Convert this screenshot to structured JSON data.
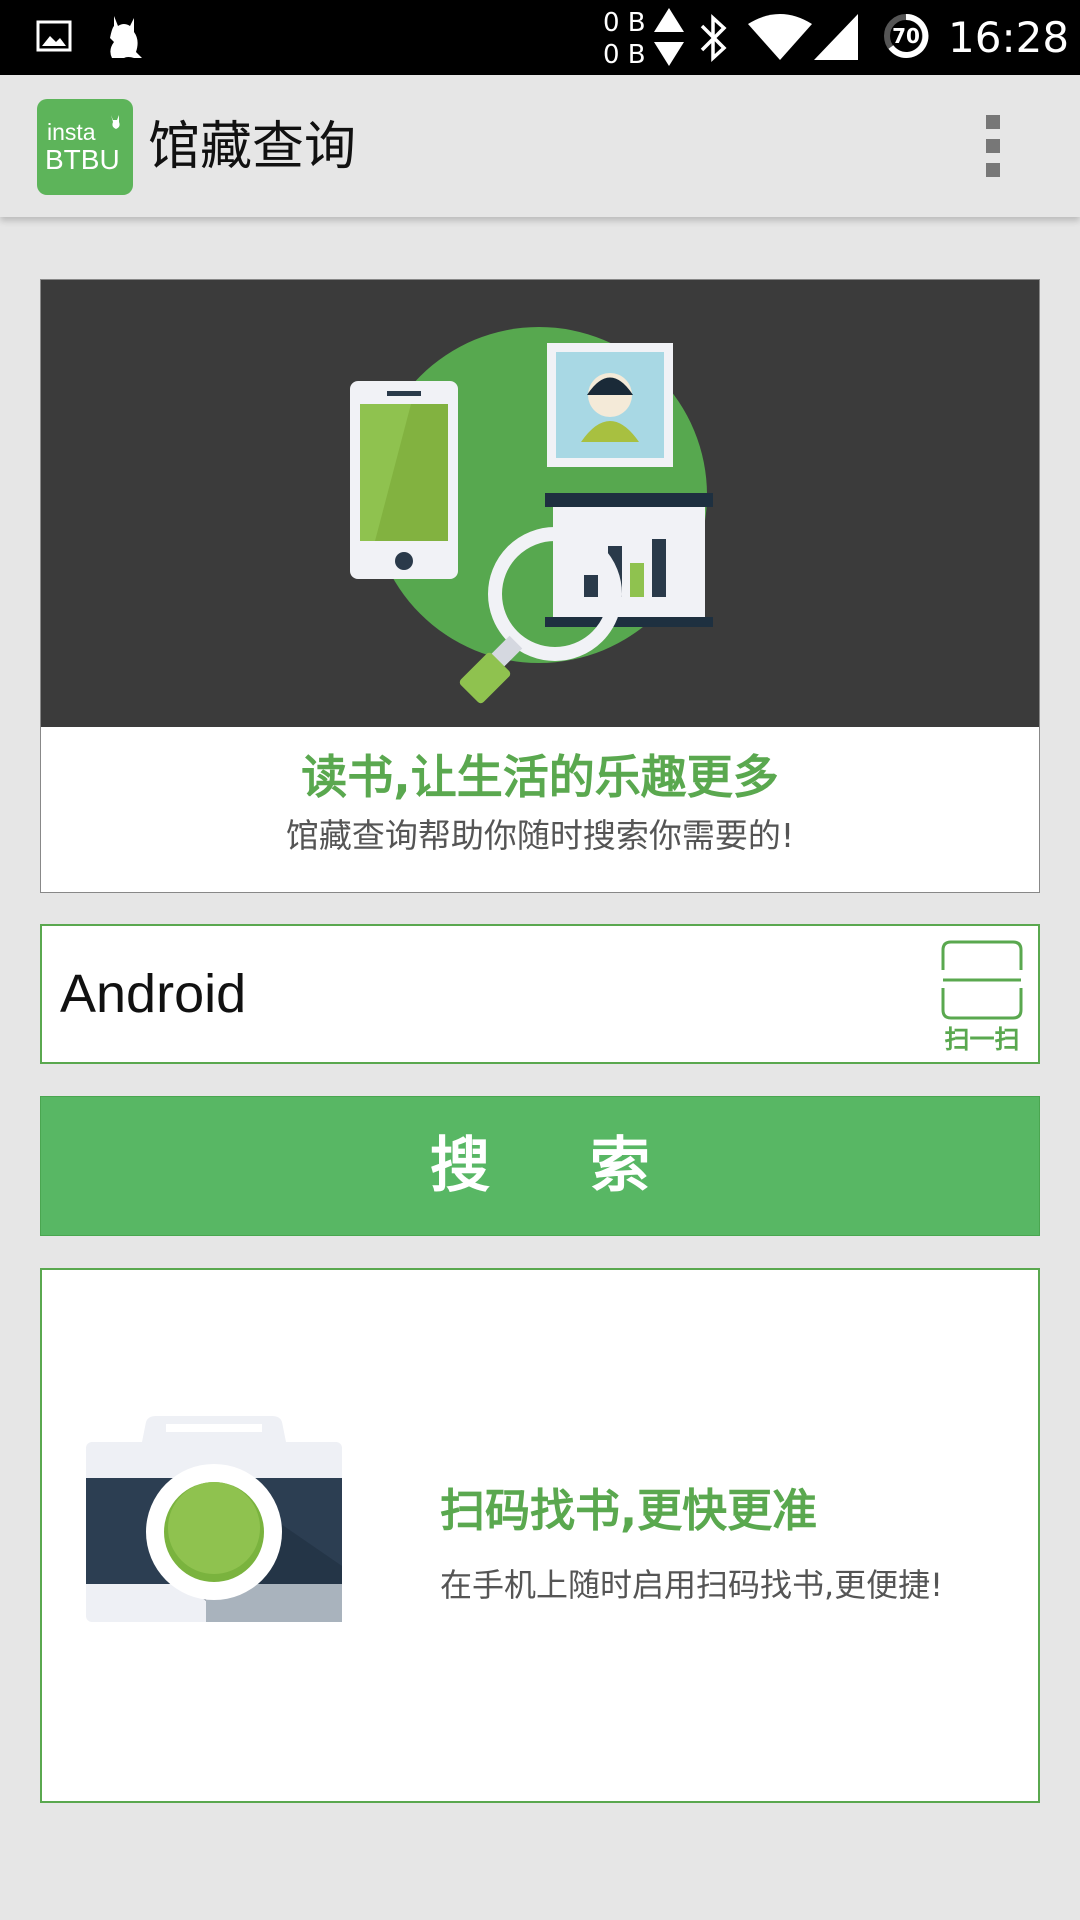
{
  "status_bar": {
    "upload_speed": "0 B",
    "download_speed": "0 B",
    "battery_level": "70",
    "time": "16:28"
  },
  "app_bar": {
    "logo_line1": "insta",
    "logo_line2": "BTBU",
    "title": "馆藏查询"
  },
  "banner": {
    "headline": "读书,让生活的乐趣更多",
    "subtitle": "馆藏查询帮助你随时搜索你需要的!"
  },
  "search": {
    "value": "Android",
    "scan_label": "扫一扫"
  },
  "search_button": {
    "label": "搜索"
  },
  "scan_card": {
    "headline": "扫码找书,更快更准",
    "subtitle": "在手机上随时启用扫码找书,更便捷!"
  },
  "colors": {
    "accent": "#5aa84f",
    "button": "#58b764",
    "banner_bg": "#3b3b3b",
    "page_bg": "#e6e6e6"
  }
}
